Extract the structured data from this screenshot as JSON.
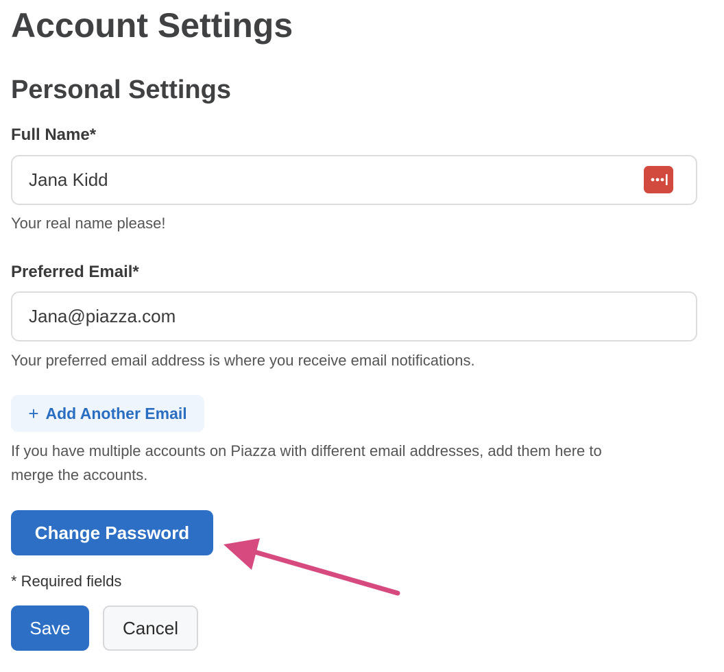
{
  "page": {
    "title": "Account Settings"
  },
  "personal": {
    "section_title": "Personal Settings",
    "full_name": {
      "label": "Full Name*",
      "value": "Jana Kidd",
      "help": "Your real name please!"
    },
    "email": {
      "label": "Preferred Email*",
      "value": "Jana@piazza.com",
      "help": "Your preferred email address is where you receive email notifications."
    },
    "add_email": {
      "icon": "plus-icon",
      "label": "Add Another Email",
      "help_line1": "If you have multiple accounts on Piazza with different email addresses, add them here to",
      "help_line2": "merge the accounts."
    },
    "change_password_label": "Change Password",
    "required_note": "* Required fields"
  },
  "actions": {
    "save_label": "Save",
    "cancel_label": "Cancel"
  },
  "icons": {
    "password_manager": "password-manager-icon",
    "annotation": "pointing-arrow"
  },
  "colors": {
    "primary": "#2d6fc4",
    "link": "#2a6ec1",
    "password_manager": "#d24a3e",
    "annotation_arrow": "#d64a7f"
  }
}
